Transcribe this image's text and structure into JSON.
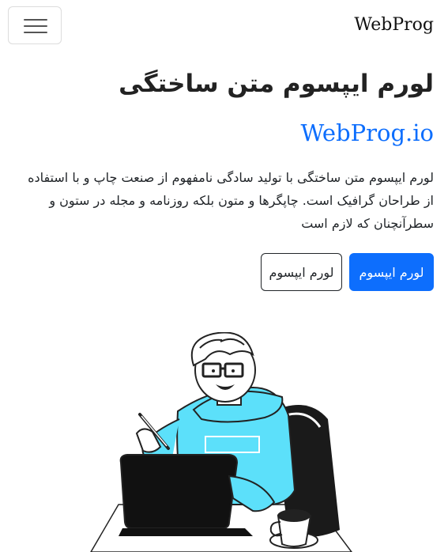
{
  "navbar": {
    "brand": "WebProg",
    "toggler_icon": "hamburger-menu-icon"
  },
  "hero": {
    "title": "لورم ایپسوم متن ساختگی",
    "subtitle": "WebProg.io",
    "text": "لورم ایپسوم متن ساختگی با تولید سادگی نامفهوم از صنعت چاپ و با استفاده از طراحان گرافیک است. چاپگرها و متون بلکه روزنامه و مجله در ستون و سطرآنچنان که لازم است",
    "buttons": [
      {
        "label": "لورم ایپسوم",
        "style": "primary"
      },
      {
        "label": "لورم ایپسوم",
        "style": "outline"
      }
    ]
  },
  "colors": {
    "primary": "#0d6efd",
    "shirt": "#5ce0fa",
    "text": "#212529"
  }
}
